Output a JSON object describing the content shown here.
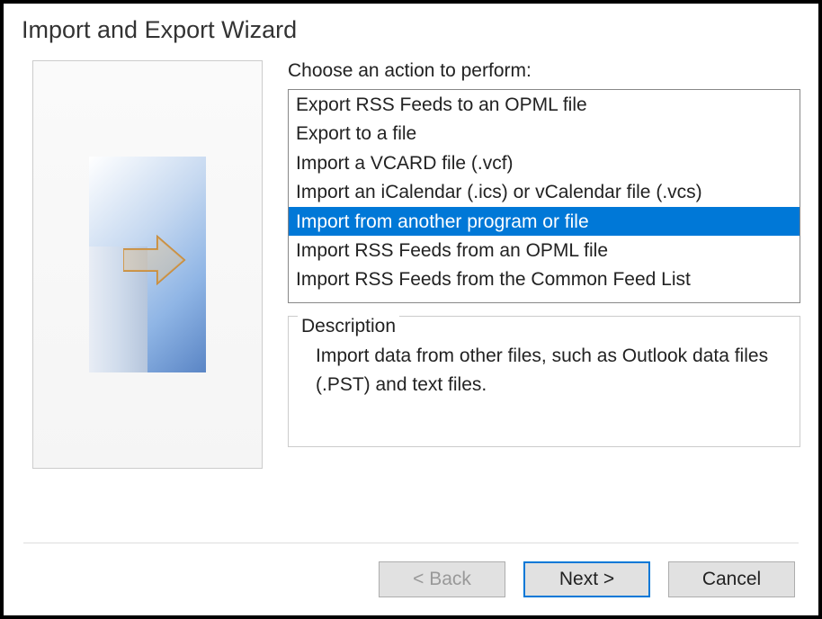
{
  "title": "Import and Export Wizard",
  "prompt": "Choose an action to perform:",
  "actions": {
    "items": [
      "Export RSS Feeds to an OPML file",
      "Export to a file",
      "Import a VCARD file (.vcf)",
      "Import an iCalendar (.ics) or vCalendar file (.vcs)",
      "Import from another program or file",
      "Import RSS Feeds from an OPML file",
      "Import RSS Feeds from the Common Feed List"
    ],
    "selectedIndex": 4
  },
  "description": {
    "legend": "Description",
    "text": "Import data from other files, such as Outlook data files (.PST) and text files."
  },
  "buttons": {
    "back": "< Back",
    "next": "Next >",
    "cancel": "Cancel"
  }
}
